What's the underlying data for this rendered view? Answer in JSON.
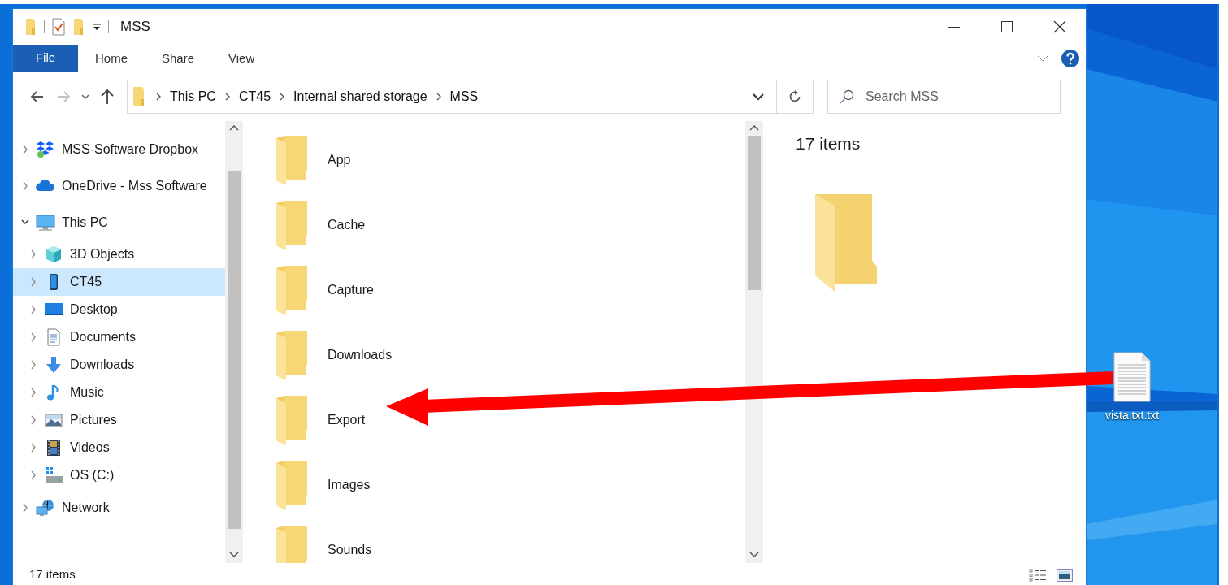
{
  "window": {
    "title": "MSS"
  },
  "ribbon": {
    "file_tab": "File",
    "tabs": [
      {
        "label": "Home",
        "selected": false
      },
      {
        "label": "Share",
        "selected": false
      },
      {
        "label": "View",
        "selected": false
      }
    ]
  },
  "navigation": {
    "back": {
      "disabled": false
    },
    "forward": {
      "disabled": true
    }
  },
  "address_bar": {
    "breadcrumbs": [
      "This PC",
      "CT45",
      "Internal shared storage",
      "MSS"
    ]
  },
  "search": {
    "placeholder": "Search MSS"
  },
  "nav_pane": {
    "items": [
      {
        "label": "MSS-Software Dropbox",
        "kind": "dropbox",
        "expanded": false,
        "selected": false
      },
      {
        "label": "OneDrive - Mss Software",
        "kind": "cloud",
        "expanded": false,
        "selected": false
      },
      {
        "label": "This PC",
        "kind": "computer",
        "expanded": true,
        "selected": false,
        "children": [
          {
            "label": "3D Objects",
            "kind": "cube",
            "expanded": false,
            "selected": false
          },
          {
            "label": "CT45",
            "kind": "phone",
            "expanded": false,
            "selected": true
          },
          {
            "label": "Desktop",
            "kind": "desktop",
            "expanded": false,
            "selected": false
          },
          {
            "label": "Documents",
            "kind": "documents",
            "expanded": false,
            "selected": false
          },
          {
            "label": "Downloads",
            "kind": "downloads",
            "expanded": false,
            "selected": false
          },
          {
            "label": "Music",
            "kind": "music",
            "expanded": false,
            "selected": false
          },
          {
            "label": "Pictures",
            "kind": "pictures",
            "expanded": false,
            "selected": false
          },
          {
            "label": "Videos",
            "kind": "videos",
            "expanded": false,
            "selected": false
          },
          {
            "label": "OS (C:)",
            "kind": "drive",
            "expanded": false,
            "selected": false
          }
        ]
      },
      {
        "label": "Network",
        "kind": "network",
        "expanded": false,
        "selected": false
      }
    ]
  },
  "folders": [
    "App",
    "Cache",
    "Capture",
    "Downloads",
    "Export",
    "Images",
    "Sounds"
  ],
  "preview_pane": {
    "item_count": "17 items"
  },
  "status_bar": {
    "item_count": "17 items"
  },
  "desktop": {
    "icons": [
      {
        "label": "vista.txt.txt"
      }
    ]
  }
}
